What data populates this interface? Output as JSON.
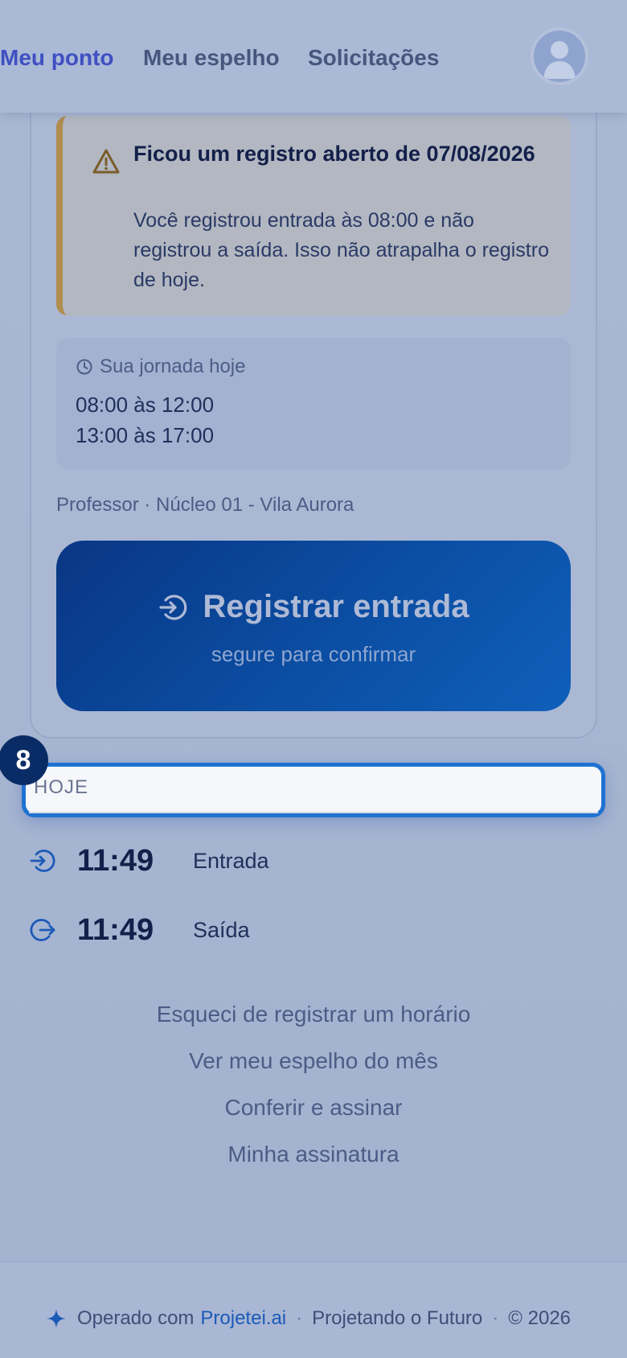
{
  "nav": {
    "items": [
      {
        "label": "Meu ponto",
        "active": true
      },
      {
        "label": "Meu espelho",
        "active": false
      },
      {
        "label": "Solicitações",
        "active": false
      }
    ],
    "avatar_icon": "user-avatar-icon"
  },
  "alert": {
    "icon": "warning-triangle-icon",
    "title": "Ficou um registro aberto de 07/08/2026",
    "body": "Você registrou entrada às 08:00 e não registrou a saída. Isso não atrapalha o registro de hoje."
  },
  "schedule": {
    "icon": "clock-icon",
    "heading": "Sua jornada hoje",
    "lines": [
      "08:00 às 12:00",
      "13:00 às 17:00"
    ]
  },
  "role_line": "Professor · Núcleo 01 - Vila Aurora",
  "register_button": {
    "icon": "login-arrow-icon",
    "label": "Registrar entrada",
    "sublabel": "segure para confirmar"
  },
  "today": {
    "badge": "8",
    "label": "HOJE",
    "punches": [
      {
        "icon": "entry-icon",
        "time": "11:49",
        "type": "Entrada"
      },
      {
        "icon": "exit-icon",
        "time": "11:49",
        "type": "Saída"
      }
    ]
  },
  "links": [
    "Esqueci de registrar um horário",
    "Ver meu espelho do mês",
    "Conferir e assinar",
    "Minha assinatura"
  ],
  "footer": {
    "icon": "sparkle-icon",
    "operated_by": "Operado com",
    "brand": "Projetei.ai",
    "tagline": "Projetando o Futuro",
    "copyright": "© 2026"
  },
  "colors": {
    "accent": "#3f4fc2",
    "primary_button": "#0b4ea3",
    "focus_border": "#1f72d1",
    "warning_border": "#b08d4f",
    "brand_link": "#1c5ab8"
  }
}
